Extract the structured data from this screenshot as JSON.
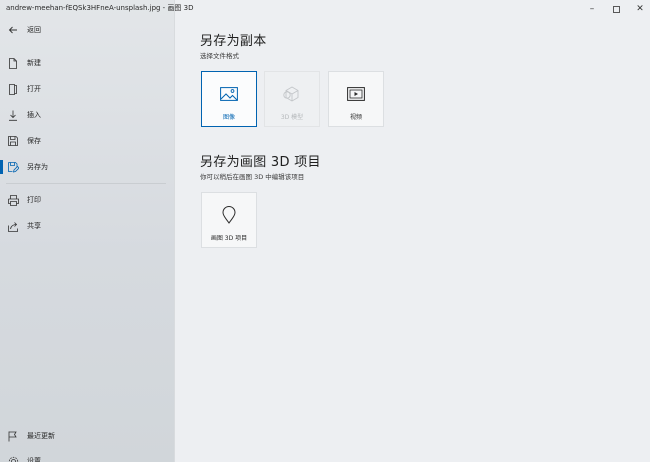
{
  "window": {
    "title": "andrew-meehan-fEQSk3HFneA-unsplash.jpg - 画图 3D",
    "minimize_glyph": "–",
    "close_glyph": "✕"
  },
  "sidebar": {
    "items": [
      {
        "label": "返回",
        "icon": "back-arrow-icon"
      },
      {
        "label": "新建",
        "icon": "new-file-icon"
      },
      {
        "label": "打开",
        "icon": "open-file-icon"
      },
      {
        "label": "插入",
        "icon": "insert-icon"
      },
      {
        "label": "保存",
        "icon": "save-icon"
      },
      {
        "label": "另存为",
        "icon": "save-as-icon",
        "active": true
      },
      {
        "label": "打印",
        "icon": "print-icon"
      },
      {
        "label": "共享",
        "icon": "share-icon"
      },
      {
        "label": "最近更新",
        "icon": "flag-icon"
      },
      {
        "label": "设置",
        "icon": "settings-icon"
      }
    ],
    "accent_color": "#0063b1"
  },
  "main": {
    "save_copy": {
      "title": "另存为副本",
      "subtitle": "选择文件格式",
      "options": [
        {
          "label": "图像",
          "icon": "image-icon",
          "state": "selected"
        },
        {
          "label": "3D 模型",
          "icon": "3d-model-icon",
          "state": "disabled"
        },
        {
          "label": "视频",
          "icon": "video-icon",
          "state": "normal"
        }
      ]
    },
    "save_project": {
      "title": "另存为画图 3D 项目",
      "subtitle": "你可以稍后在画图 3D 中编辑该项目",
      "options": [
        {
          "label": "画图 3D 项目",
          "icon": "paint3d-project-icon",
          "state": "normal"
        }
      ]
    }
  }
}
